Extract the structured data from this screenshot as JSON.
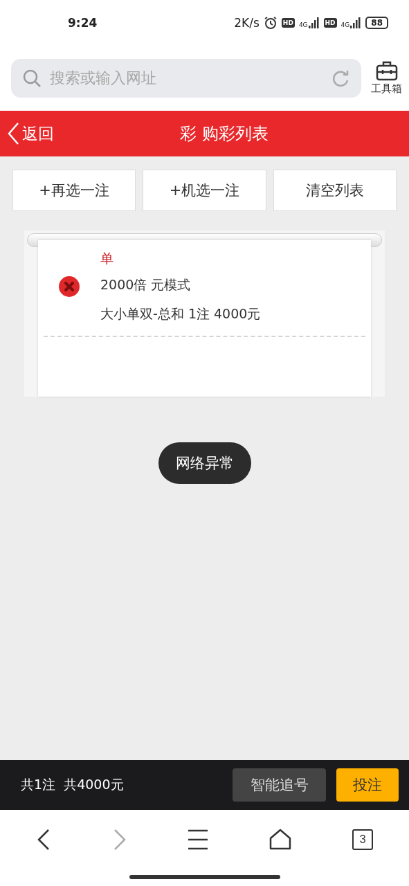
{
  "status_bar": {
    "time": "9:24",
    "speed": "2K/s",
    "sim_labels": [
      "HD",
      "HD"
    ],
    "network_labels": [
      "4G",
      "4G"
    ],
    "battery": "88"
  },
  "browser": {
    "search": {
      "placeholder": "搜索或输入网址"
    },
    "toolbox": "工具箱"
  },
  "header": {
    "back": "返回",
    "title": "彩 购彩列表"
  },
  "actions": [
    "+再选一注",
    "+机选一注",
    "清空列表"
  ],
  "bets": [
    {
      "tag": "单",
      "mode": "2000倍 元模式",
      "detail": "大小单双-总和 1注 4000元"
    }
  ],
  "toast": "网络异常",
  "footer": {
    "summary": "共1注  共4000元",
    "buttons": [
      {
        "label": "智能追号",
        "kind": "secondary"
      },
      {
        "label": "投注",
        "kind": "primary"
      }
    ]
  },
  "nav": [
    {
      "kind": "back",
      "disabled": false
    },
    {
      "kind": "forward",
      "disabled": true
    },
    {
      "kind": "menu",
      "disabled": false
    },
    {
      "kind": "home",
      "disabled": false
    },
    {
      "kind": "tabs",
      "label": "3",
      "disabled": false
    }
  ]
}
